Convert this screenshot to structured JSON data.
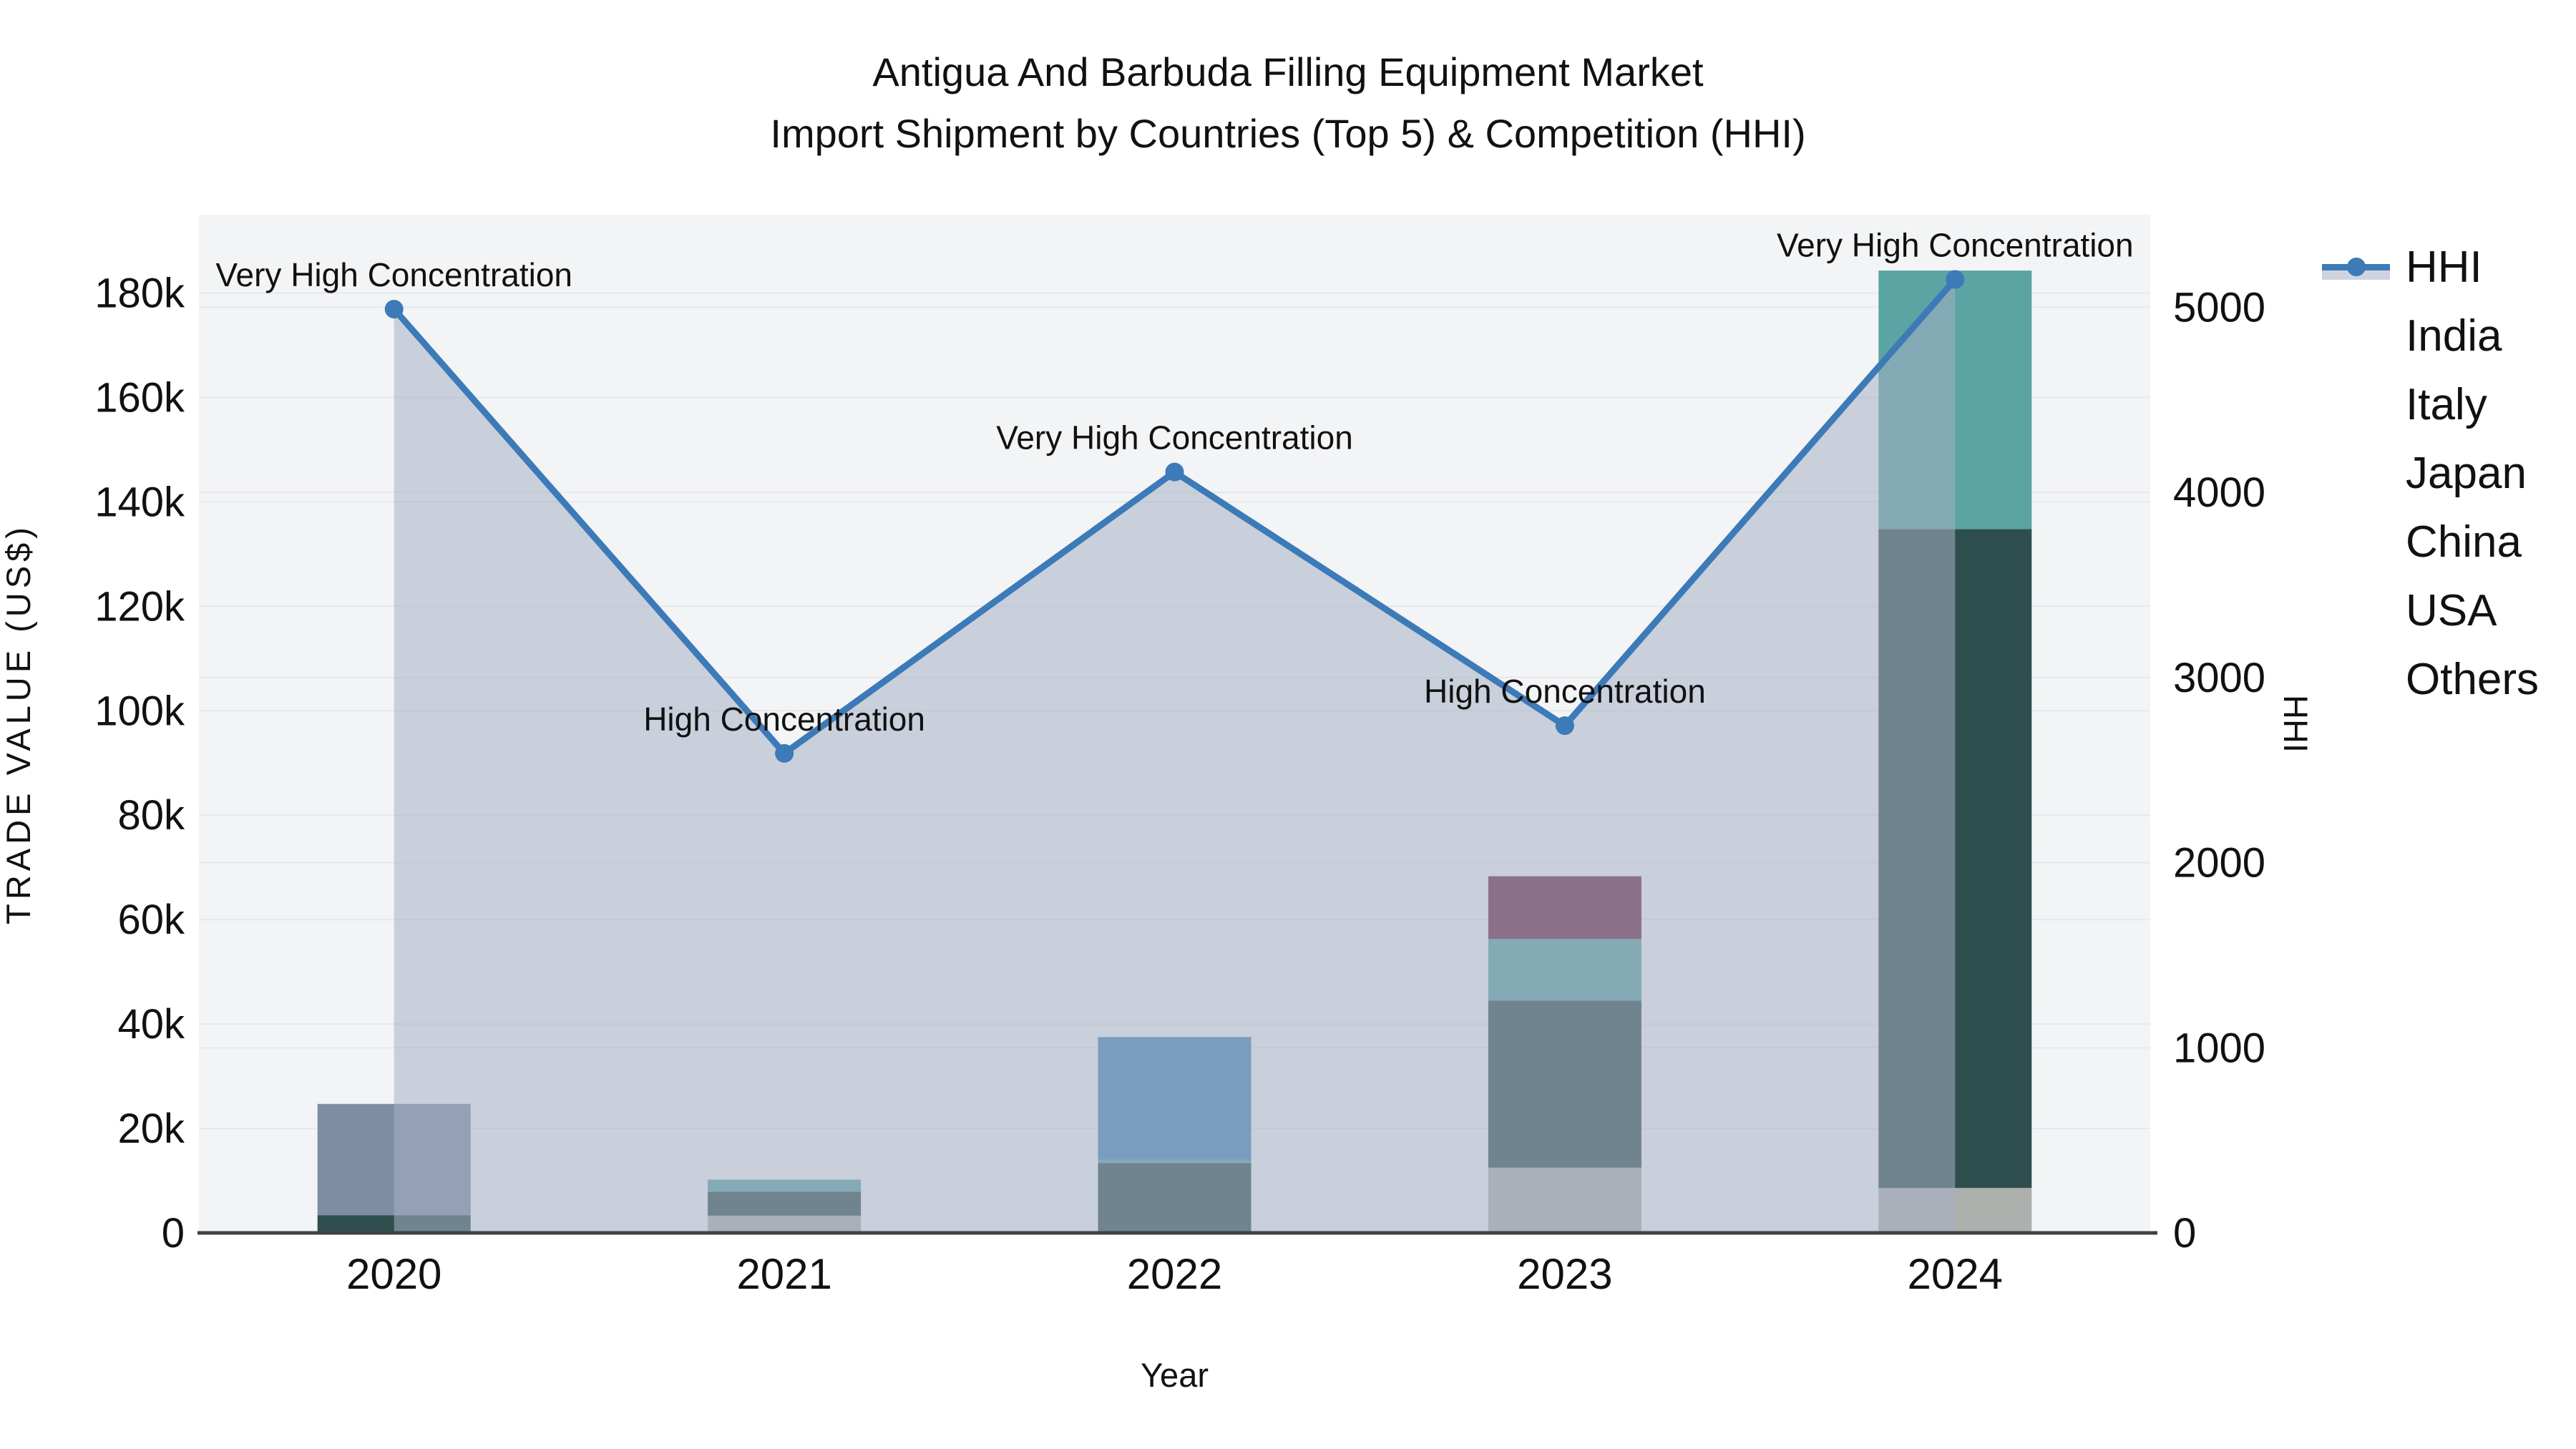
{
  "title": {
    "line1": "Antigua And Barbuda Filling Equipment Market",
    "line2": "Import Shipment by Countries (Top 5) & Competition (HHI)"
  },
  "chart_data": {
    "type": "bar+line",
    "title": "Antigua And Barbuda Filling Equipment Market — Import Shipment by Countries (Top 5) & Competition (HHI)",
    "categories": [
      "2020",
      "2021",
      "2022",
      "2023",
      "2024"
    ],
    "bar_series": [
      {
        "name": "Others",
        "color": "#AEB0AE",
        "values": [
          0,
          3300,
          0,
          12500,
          8600
        ]
      },
      {
        "name": "USA",
        "color": "#2E4E4D",
        "values": [
          3400,
          4600,
          13400,
          32000,
          126200
        ]
      },
      {
        "name": "China",
        "color": "#5CA3A3",
        "values": [
          0,
          2300,
          600,
          11800,
          49500
        ]
      },
      {
        "name": "Japan",
        "color": "#4583B5",
        "values": [
          0,
          0,
          23500,
          0,
          0
        ]
      },
      {
        "name": "Italy",
        "color": "#7E8DA3",
        "values": [
          21300,
          0,
          0,
          0,
          0
        ]
      },
      {
        "name": "India",
        "color": "#6B2343",
        "values": [
          0,
          0,
          0,
          12000,
          0
        ]
      }
    ],
    "bar_totals": [
      24700,
      10200,
      37500,
      68300,
      184300
    ],
    "line_series": {
      "name": "HHI",
      "color": "#3C7AB8",
      "area_fill": "rgba(165,177,196,0.55)",
      "values": [
        4990,
        2590,
        4110,
        2740,
        5150
      ]
    },
    "annotations": [
      "Very High Concentration",
      "High Concentration",
      "Very High Concentration",
      "High Concentration",
      "Very High Concentration"
    ],
    "left_axis": {
      "title": "TRADE VALUE (US$)",
      "ticks": [
        "0",
        "20k",
        "40k",
        "60k",
        "80k",
        "100k",
        "120k",
        "140k",
        "160k",
        "180k"
      ],
      "tick_values": [
        0,
        20000,
        40000,
        60000,
        80000,
        100000,
        120000,
        140000,
        160000,
        180000
      ],
      "max": 195000
    },
    "right_axis": {
      "title": "HHI",
      "ticks": [
        "0",
        "1000",
        "2000",
        "3000",
        "4000",
        "5000"
      ],
      "tick_values": [
        0,
        1000,
        2000,
        3000,
        4000,
        5000
      ],
      "max": 5500
    },
    "x_axis": {
      "title": "Year"
    },
    "legend": [
      {
        "label": "HHI",
        "type": "line",
        "color": "#3C7AB8"
      },
      {
        "label": "India",
        "type": "square",
        "color": "#6B2343"
      },
      {
        "label": "Italy",
        "type": "square",
        "color": "#7E8DA3"
      },
      {
        "label": "Japan",
        "type": "square",
        "color": "#4583B5"
      },
      {
        "label": "China",
        "type": "square",
        "color": "#5CA3A3"
      },
      {
        "label": "USA",
        "type": "square",
        "color": "#2E4E4D"
      },
      {
        "label": "Others",
        "type": "square",
        "color": "#AEB0AE"
      }
    ],
    "plot_bg": "#f3f4f5",
    "grid_color": "#e6e8ec",
    "axis_line_color": "#3f4245",
    "legend_position": "top-right"
  }
}
